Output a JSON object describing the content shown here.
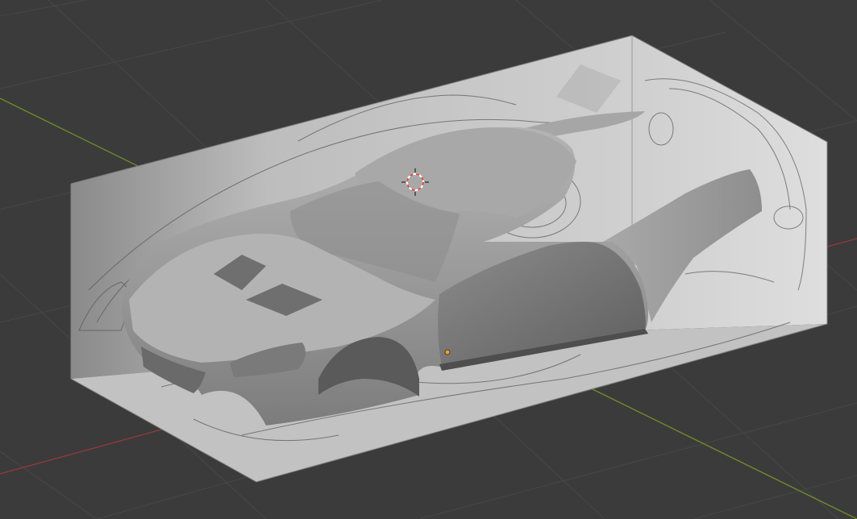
{
  "viewport": {
    "background_color": "#3b3b3b",
    "grid_color": "#474747",
    "x_axis_color": "#8f3a3a",
    "y_axis_color": "#6c8a2a"
  },
  "reference_box": {
    "top_face_color": "#dcdcdc",
    "front_face_color": "#c9c9c9",
    "side_face_color": "#d8d8d8"
  },
  "car_model": {
    "body_color": "#9a9a9a",
    "shadow_color": "#6e6e6e",
    "highlight_color": "#c4c4c4"
  },
  "cursor_3d": {
    "ring_color": "#d94a4a"
  },
  "origin_point": {
    "color": "#f0a030"
  }
}
